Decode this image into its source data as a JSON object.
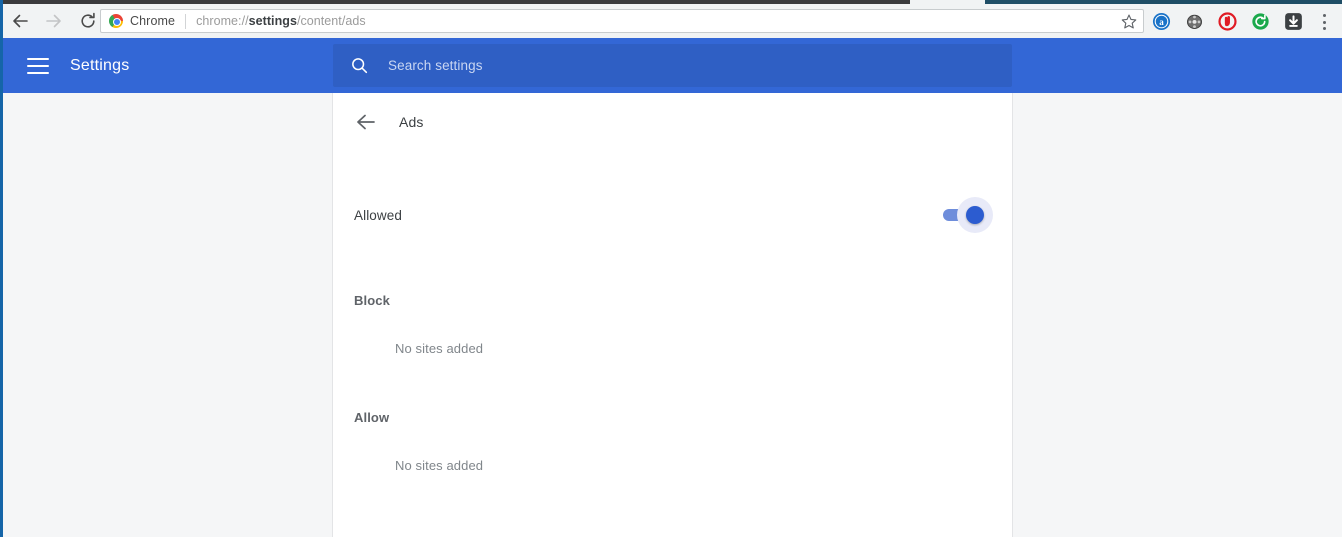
{
  "browser": {
    "nav": {
      "back_icon": "back-arrow-icon",
      "forward_icon": "forward-arrow-icon",
      "reload_icon": "reload-icon"
    },
    "omnibox": {
      "brand_label": "Chrome",
      "brand_icon": "chrome-logo-icon",
      "url_prefix": "chrome://",
      "url_strong": "settings",
      "url_suffix": "/content/ads",
      "full_url": "chrome://settings/content/ads",
      "bookmark_icon": "star-icon"
    },
    "extensions": [
      {
        "name": "adblock-extension-icon",
        "color": "#1a73c8",
        "letter": "a"
      },
      {
        "name": "film-reel-extension-icon",
        "color": "#6f6f6f"
      },
      {
        "name": "stop-hand-extension-icon",
        "color": "#e01b24"
      },
      {
        "name": "refresh-extension-icon",
        "color": "#1ba94c"
      },
      {
        "name": "download-extension-icon",
        "color": "#3c4043"
      }
    ],
    "menu_icon": "three-dot-menu-icon"
  },
  "settings_header": {
    "menu_icon": "hamburger-menu-icon",
    "title": "Settings",
    "search": {
      "icon": "search-icon",
      "placeholder": "Search settings",
      "value": ""
    },
    "accent_color": "#3367d6"
  },
  "main": {
    "back_icon": "back-arrow-icon",
    "title": "Ads",
    "allowed": {
      "label": "Allowed",
      "toggle_state": "on",
      "toggle_color": "#2c5cd0"
    },
    "sections": [
      {
        "title": "Block",
        "empty_text": "No sites added"
      },
      {
        "title": "Allow",
        "empty_text": "No sites added"
      }
    ]
  }
}
